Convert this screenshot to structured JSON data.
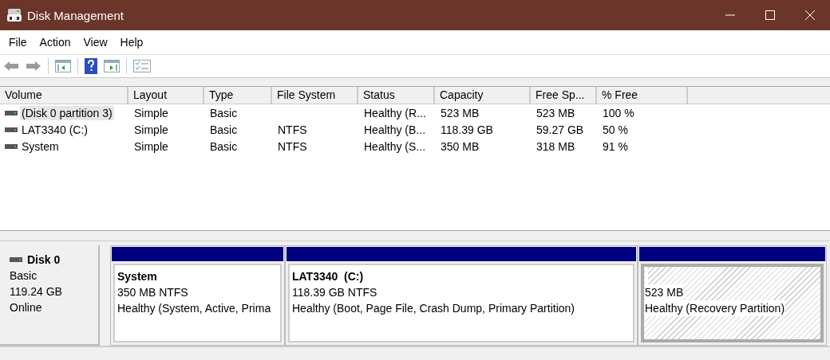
{
  "window": {
    "title": "Disk Management"
  },
  "menu": [
    "File",
    "Action",
    "View",
    "Help"
  ],
  "table": {
    "columns": [
      "Volume",
      "Layout",
      "Type",
      "File System",
      "Status",
      "Capacity",
      "Free Sp...",
      "% Free"
    ],
    "rows": [
      {
        "selected": true,
        "cells": [
          "(Disk 0 partition 3)",
          "Simple",
          "Basic",
          "",
          "Healthy (R...",
          "523 MB",
          "523 MB",
          "100 %"
        ]
      },
      {
        "selected": false,
        "cells": [
          "LAT3340 (C:)",
          "Simple",
          "Basic",
          "NTFS",
          "Healthy (B...",
          "118.39 GB",
          "59.27 GB",
          "50 %"
        ]
      },
      {
        "selected": false,
        "cells": [
          "System",
          "Simple",
          "Basic",
          "NTFS",
          "Healthy (S...",
          "350 MB",
          "318 MB",
          "91 %"
        ]
      }
    ]
  },
  "disk": {
    "name": "Disk 0",
    "type": "Basic",
    "size": "119.24 GB",
    "status": "Online",
    "partitions": [
      {
        "name": "System",
        "size": "350 MB NTFS",
        "status": "Healthy (System, Active, Prima",
        "selected": false
      },
      {
        "name": "LAT3340  (C:)",
        "size": "118.39 GB NTFS",
        "status": "Healthy (Boot, Page File, Crash Dump, Primary Partition)",
        "selected": false
      },
      {
        "size": "523 MB",
        "status": "Healthy (Recovery Partition)",
        "selected": true
      }
    ]
  }
}
